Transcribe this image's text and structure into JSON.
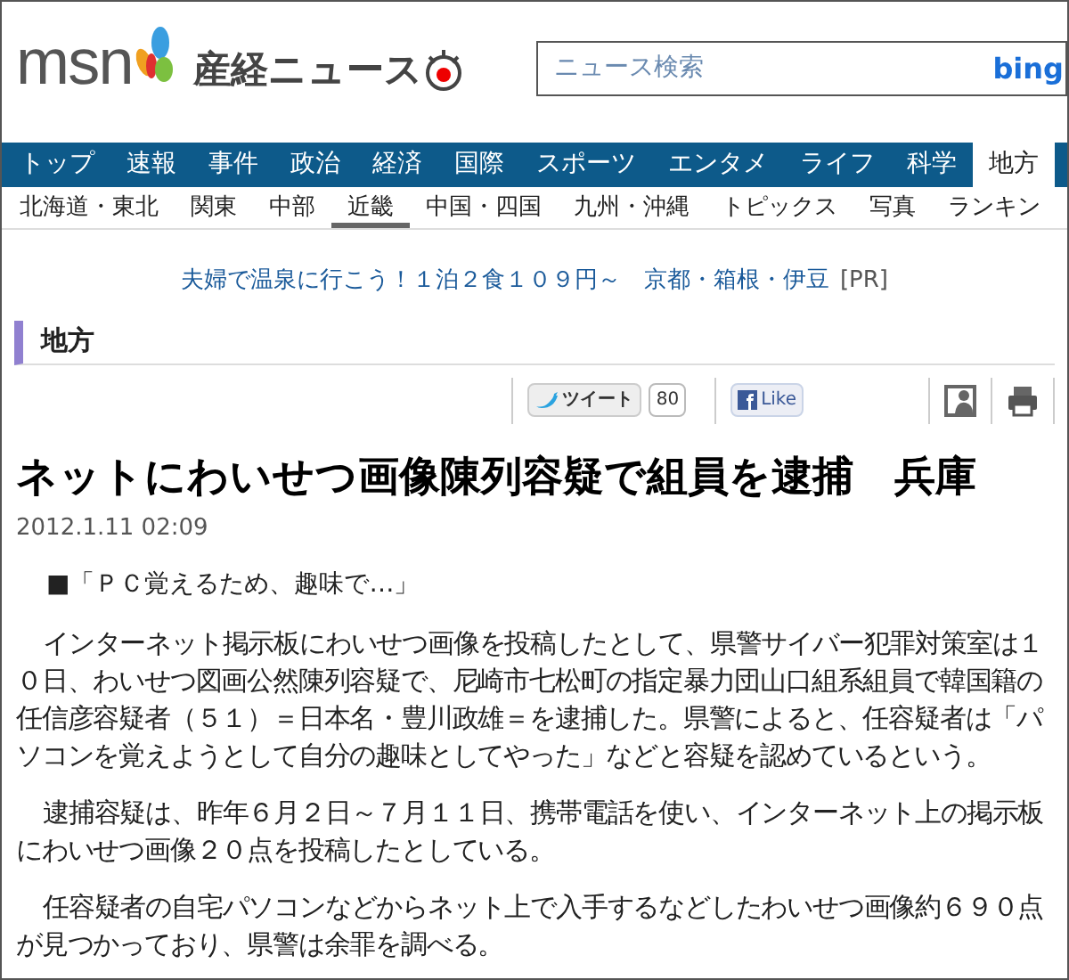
{
  "header": {
    "logo": "msn",
    "site_name": "産経ニュース",
    "search": {
      "placeholder": "ニュース検索",
      "engine": "bing"
    }
  },
  "nav": [
    {
      "label": "トップ",
      "selected": false
    },
    {
      "label": "速報",
      "selected": false
    },
    {
      "label": "事件",
      "selected": false
    },
    {
      "label": "政治",
      "selected": false
    },
    {
      "label": "経済",
      "selected": false
    },
    {
      "label": "国際",
      "selected": false
    },
    {
      "label": "スポーツ",
      "selected": false
    },
    {
      "label": "エンタメ",
      "selected": false
    },
    {
      "label": "ライフ",
      "selected": false
    },
    {
      "label": "科学",
      "selected": false
    },
    {
      "label": "地方",
      "selected": true
    }
  ],
  "subnav": [
    {
      "label": "北海道・東北",
      "selected": false
    },
    {
      "label": "関東",
      "selected": false
    },
    {
      "label": "中部",
      "selected": false
    },
    {
      "label": "近畿",
      "selected": true
    },
    {
      "label": "中国・四国",
      "selected": false
    },
    {
      "label": "九州・沖縄",
      "selected": false
    },
    {
      "label": "トピックス",
      "selected": false
    },
    {
      "label": "写真",
      "selected": false
    },
    {
      "label": "ランキン",
      "selected": false
    }
  ],
  "ad": {
    "text": "夫婦で温泉に行こう！１泊２食１０９円～　京都・箱根・伊豆",
    "tag": "[PR]"
  },
  "section": "地方",
  "social": {
    "tweet": "ツイート",
    "tweet_count": "80",
    "like": "Like"
  },
  "article": {
    "headline": "ネットにわいせつ画像陳列容疑で組員を逮捕　兵庫",
    "date": "2012.1.11 02:09",
    "subhead": "■「ＰＣ覚えるため、趣味で…」",
    "paragraphs": [
      "インターネット掲示板にわいせつ画像を投稿したとして、県警サイバー犯罪対策室は１０日、わいせつ図画公然陳列容疑で、尼崎市七松町の指定暴力団山口組系組員で韓国籍の任信彦容疑者（５１）＝日本名・豊川政雄＝を逮捕した。県警によると、任容疑者は「パソコンを覚えようとして自分の趣味としてやった」などと容疑を認めているという。",
      "逮捕容疑は、昨年６月２日～７月１１日、携帯電話を使い、インターネット上の掲示板にわいせつ画像２０点を投稿したとしている。",
      "任容疑者の自宅パソコンなどからネット上で入手するなどしたわいせつ画像約６９０点が見つかっており、県警は余罪を調べる。"
    ]
  }
}
